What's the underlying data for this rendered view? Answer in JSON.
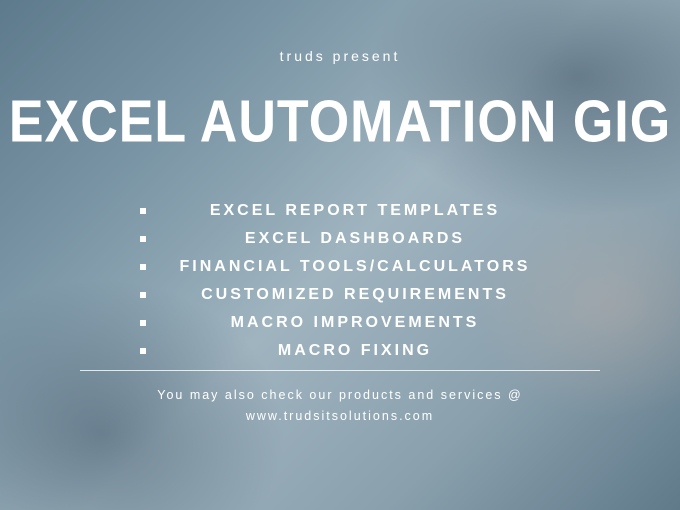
{
  "pretitle": "truds present",
  "title": "EXCEL AUTOMATION GIG",
  "bullets": [
    "EXCEL REPORT TEMPLATES",
    "EXCEL DASHBOARDS",
    "FINANCIAL TOOLS/CALCULATORS",
    "CUSTOMIZED REQUIREMENTS",
    "MACRO IMPROVEMENTS",
    "MACRO FIXING"
  ],
  "footer_line1": "You may also check our products and services @",
  "footer_line2": "www.trudsitsolutions.com"
}
